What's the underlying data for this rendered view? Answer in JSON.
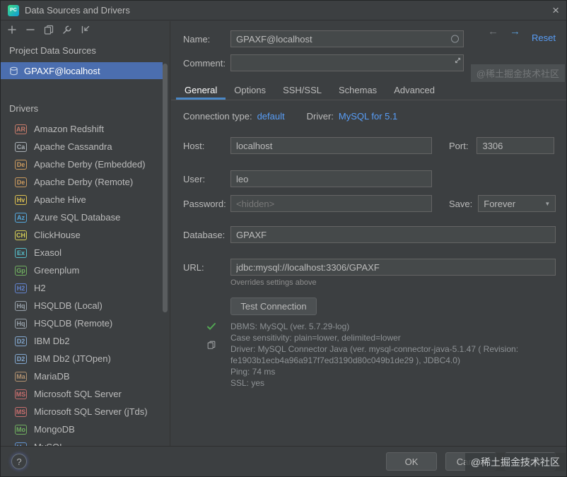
{
  "window": {
    "title": "Data Sources and Drivers",
    "app_badge": "PC",
    "close_glyph": "×"
  },
  "sidebar": {
    "project_header": "Project Data Sources",
    "datasources": [
      {
        "label": "GPAXF@localhost",
        "selected": true
      }
    ],
    "drivers_header": "Drivers",
    "drivers": [
      {
        "label": "Amazon Redshift",
        "abbr": "AR",
        "color": "#c77b6a"
      },
      {
        "label": "Apache Cassandra",
        "abbr": "Ca",
        "color": "#a9b0b6"
      },
      {
        "label": "Apache Derby (Embedded)",
        "abbr": "De",
        "color": "#cb9a5e"
      },
      {
        "label": "Apache Derby (Remote)",
        "abbr": "De",
        "color": "#cb9a5e"
      },
      {
        "label": "Apache Hive",
        "abbr": "Hv",
        "color": "#dcc050"
      },
      {
        "label": "Azure SQL Database",
        "abbr": "Az",
        "color": "#55a8dc"
      },
      {
        "label": "ClickHouse",
        "abbr": "CH",
        "color": "#d6ce55"
      },
      {
        "label": "Exasol",
        "abbr": "Ex",
        "color": "#55bdc9"
      },
      {
        "label": "Greenplum",
        "abbr": "Gp",
        "color": "#6fae5f"
      },
      {
        "label": "H2",
        "abbr": "H2",
        "color": "#6283cf"
      },
      {
        "label": "HSQLDB (Local)",
        "abbr": "Hq",
        "color": "#98a2ab"
      },
      {
        "label": "HSQLDB (Remote)",
        "abbr": "Hq",
        "color": "#98a2ab"
      },
      {
        "label": "IBM Db2",
        "abbr": "D2",
        "color": "#82a7cf"
      },
      {
        "label": "IBM Db2 (JTOpen)",
        "abbr": "D2",
        "color": "#82a7cf"
      },
      {
        "label": "MariaDB",
        "abbr": "Ma",
        "color": "#b29270"
      },
      {
        "label": "Microsoft SQL Server",
        "abbr": "MS",
        "color": "#c76e6e"
      },
      {
        "label": "Microsoft SQL Server (jTds)",
        "abbr": "MS",
        "color": "#c76e6e"
      },
      {
        "label": "MongoDB",
        "abbr": "Mo",
        "color": "#6fae5f"
      },
      {
        "label": "MySQL",
        "abbr": "My",
        "color": "#6293cf"
      }
    ]
  },
  "main": {
    "name_label": "Name:",
    "name_value": "GPAXF@localhost",
    "reset_label": "Reset",
    "comment_label": "Comment:",
    "comment_value": "",
    "tabs": [
      {
        "label": "General",
        "selected": true
      },
      {
        "label": "Options"
      },
      {
        "label": "SSH/SSL"
      },
      {
        "label": "Schemas"
      },
      {
        "label": "Advanced"
      }
    ],
    "connection_type_label": "Connection type:",
    "connection_type_value": "default",
    "driver_label": "Driver:",
    "driver_value": "MySQL for 5.1",
    "host_label": "Host:",
    "host_value": "localhost",
    "port_label": "Port:",
    "port_value": "3306",
    "user_label": "User:",
    "user_value": "leo",
    "password_label": "Password:",
    "password_placeholder": "<hidden>",
    "save_label": "Save:",
    "save_value": "Forever",
    "database_label": "Database:",
    "database_value": "GPAXF",
    "url_label": "URL:",
    "url_value": "jdbc:mysql://localhost:3306/GPAXF",
    "url_hint": "Overrides settings above",
    "test_button_label": "Test Connection",
    "result_lines": [
      "DBMS: MySQL (ver. 5.7.29-log)",
      "Case sensitivity: plain=lower, delimited=lower",
      "Driver: MySQL Connector Java (ver. mysql-connector-java-5.1.47 ( Revision: fe1903b1ecb4a96a917f7ed3190d80c049b1de29 ), JDBC4.0)",
      "Ping: 74 ms",
      "SSL: yes"
    ]
  },
  "footer": {
    "help": "?",
    "ok": "OK",
    "cancel": "Cancel",
    "apply": "Apply"
  },
  "watermark": {
    "text": "@稀土掘金技术社区"
  }
}
